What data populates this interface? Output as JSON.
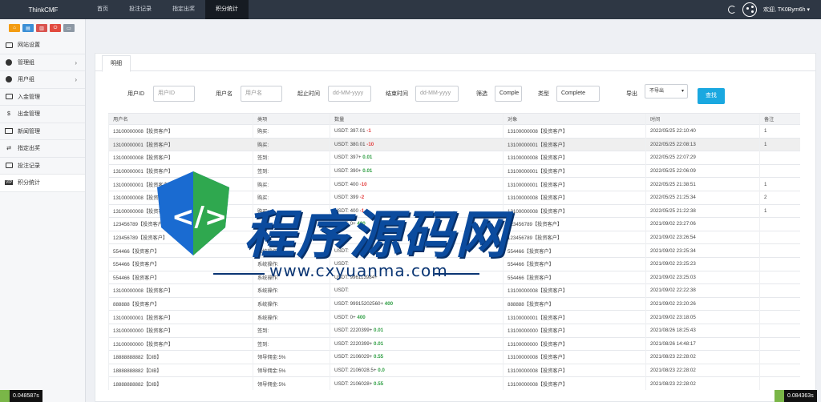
{
  "brand": "ThinkCMF",
  "nav": [
    {
      "label": "首页",
      "active": false
    },
    {
      "label": "投注记录",
      "active": false
    },
    {
      "label": "指定出奖",
      "active": false
    },
    {
      "label": "积分统计",
      "active": true
    }
  ],
  "user": {
    "welcome": "欢迎, TK0Bym6h ▾"
  },
  "sidebar": {
    "items": [
      {
        "label": "网站设置",
        "icon": "monitor-icon",
        "chevron": false
      },
      {
        "label": "管理组",
        "icon": "user-circle-icon",
        "chevron": true
      },
      {
        "label": "用户组",
        "icon": "user-circle-icon",
        "chevron": true
      },
      {
        "label": "入金管理",
        "icon": "monitor-icon",
        "chevron": false
      },
      {
        "label": "出金管理",
        "icon": "dollar-icon",
        "chevron": false
      },
      {
        "label": "新闻管理",
        "icon": "newspaper-icon",
        "chevron": false
      },
      {
        "label": "指定出奖",
        "icon": "swap-icon",
        "chevron": false
      },
      {
        "label": "投注记录",
        "icon": "monitor-icon",
        "chevron": false
      },
      {
        "label": "积分统计",
        "icon": "vip-icon",
        "chevron": false
      }
    ]
  },
  "tab": {
    "label": "明细"
  },
  "filters": {
    "user_id_label": "用户ID",
    "user_id_placeholder": "用户ID",
    "username_label": "用户名",
    "username_placeholder": "用户名",
    "start_label": "起止时间",
    "start_placeholder": "dd-MM-yyyy",
    "end_label": "结束时间",
    "end_placeholder": "dd-MM-yyyy",
    "filter_label": "筛选",
    "filter_value": "Comple",
    "type_label": "类型",
    "type_value": "Complete",
    "export_label": "导出",
    "export_value": "不导出",
    "search_label": "查找"
  },
  "table": {
    "headers": [
      "用户名",
      "类项",
      "数量",
      "对象",
      "时间",
      "备注"
    ],
    "rows": [
      {
        "user": "13100000008【投资客户】",
        "type": "购买:",
        "amount": "USDT: 397.01",
        "delta": "-1",
        "sign": "neg",
        "target": "13100000008【投资客户】",
        "time": "2022/05/25 22:10:40",
        "note": "1",
        "hl": false
      },
      {
        "user": "13100000001【投资客户】",
        "type": "购买:",
        "amount": "USDT: 380.01",
        "delta": "-10",
        "sign": "neg",
        "target": "13100000001【投资客户】",
        "time": "2022/05/25 22:08:13",
        "note": "1",
        "hl": true
      },
      {
        "user": "13100000008【投资客户】",
        "type": "签到:",
        "amount": "USDT: 397+",
        "delta": "0.01",
        "sign": "pos",
        "target": "13100000008【投资客户】",
        "time": "2022/05/25 22:07:29",
        "note": "",
        "hl": false
      },
      {
        "user": "13100000001【投资客户】",
        "type": "签到:",
        "amount": "USDT: 390+",
        "delta": "0.01",
        "sign": "pos",
        "target": "13100000001【投资客户】",
        "time": "2022/05/25 22:06:09",
        "note": "",
        "hl": false
      },
      {
        "user": "13100000001【投资客户】",
        "type": "购买:",
        "amount": "USDT: 400",
        "delta": "-10",
        "sign": "neg",
        "target": "13100000001【投资客户】",
        "time": "2022/05/25 21:38:51",
        "note": "1",
        "hl": false
      },
      {
        "user": "13100000008【投资客户】",
        "type": "购买:",
        "amount": "USDT: 399",
        "delta": "-2",
        "sign": "neg",
        "target": "13100000008【投资客户】",
        "time": "2022/05/25 21:25:34",
        "note": "2",
        "hl": false
      },
      {
        "user": "13100000008【投资客户】",
        "type": "购买:",
        "amount": "USDT: 400",
        "delta": "-1",
        "sign": "neg",
        "target": "13100000008【投资客户】",
        "time": "2022/05/25 21:22:38",
        "note": "1",
        "hl": false
      },
      {
        "user": "123456789【投资客户】",
        "type": "",
        "amount": "USDT: 0+",
        "delta": "400",
        "sign": "pos",
        "target": "123456789【投资客户】",
        "time": "2021/09/02 23:27:06",
        "note": "",
        "hl": false
      },
      {
        "user": "123456789【投资客户】",
        "type": "",
        "amount": "USDT:",
        "delta": "",
        "sign": "pos",
        "target": "123456789【投资客户】",
        "time": "2021/09/02 23:26:54",
        "note": "",
        "hl": false
      },
      {
        "user": "554466【投资客户】",
        "type": "系统操作:",
        "amount": "USDT:",
        "delta": "",
        "sign": "pos",
        "target": "554466【投资客户】",
        "time": "2021/09/02 23:25:34",
        "note": "",
        "hl": false
      },
      {
        "user": "554466【投资客户】",
        "type": "系统操作:",
        "amount": "USDT:",
        "delta": "",
        "sign": "pos",
        "target": "554466【投资客户】",
        "time": "2021/09/02 23:25:23",
        "note": "",
        "hl": false
      },
      {
        "user": "554466【投资客户】",
        "type": "系统操作:",
        "amount": "USDT: 996113984+",
        "delta": "",
        "sign": "pos",
        "target": "554466【投资客户】",
        "time": "2021/09/02 23:25:03",
        "note": "",
        "hl": false
      },
      {
        "user": "13100000008【投资客户】",
        "type": "系统操作:",
        "amount": "USDT:",
        "delta": "",
        "sign": "pos",
        "target": "13100000008【投资客户】",
        "time": "2021/09/02 22:22:38",
        "note": "",
        "hl": false
      },
      {
        "user": "888888【投资客户】",
        "type": "系统操作:",
        "amount": "USDT: 99915202560+",
        "delta": "400",
        "sign": "pos",
        "target": "888888【投资客户】",
        "time": "2021/09/02 23:20:26",
        "note": "",
        "hl": false
      },
      {
        "user": "13100000001【投资客户】",
        "type": "系统操作:",
        "amount": "USDT: 0+",
        "delta": "400",
        "sign": "pos",
        "target": "13100000001【投资客户】",
        "time": "2021/09/02 23:18:05",
        "note": "",
        "hl": false
      },
      {
        "user": "13100000000【投资客户】",
        "type": "签到:",
        "amount": "USDT: 2220399+",
        "delta": "0.01",
        "sign": "pos",
        "target": "13100000000【投资客户】",
        "time": "2021/08/26 18:25:43",
        "note": "",
        "hl": false
      },
      {
        "user": "13100000000【投资客户】",
        "type": "签到:",
        "amount": "USDT: 2220399+",
        "delta": "0.01",
        "sign": "pos",
        "target": "13100000000【投资客户】",
        "time": "2021/08/26 14:48:17",
        "note": "",
        "hl": false
      },
      {
        "user": "18888888882【DIB】",
        "type": "领导佣金:5%",
        "amount": "USDT: 2106029+",
        "delta": "0.55",
        "sign": "pos",
        "target": "13100000008【投资客户】",
        "time": "2021/08/23 22:28:02",
        "note": "",
        "hl": false
      },
      {
        "user": "18888888882【DIB】",
        "type": "领导佣金:5%",
        "amount": "USDT: 2106028.5+",
        "delta": "0.0",
        "sign": "pos",
        "target": "13100000008【投资客户】",
        "time": "2021/08/23 22:28:02",
        "note": "",
        "hl": false
      },
      {
        "user": "18888888882【DIB】",
        "type": "领导佣金:5%",
        "amount": "USDT: 2106028+",
        "delta": "0.55",
        "sign": "pos",
        "target": "13100000008【投资客户】",
        "time": "2021/08/23 22:28:02",
        "note": "",
        "hl": false
      }
    ]
  },
  "watermark": {
    "title": "程序源码网",
    "url": "www.cxyuanma.com"
  },
  "badges": {
    "left": "0.048587s",
    "right": "0.084363s"
  },
  "colors": {
    "topbar": "#2e3744",
    "accent": "#1aa8e0",
    "negative": "#e34141",
    "positive": "#2e9e43"
  }
}
